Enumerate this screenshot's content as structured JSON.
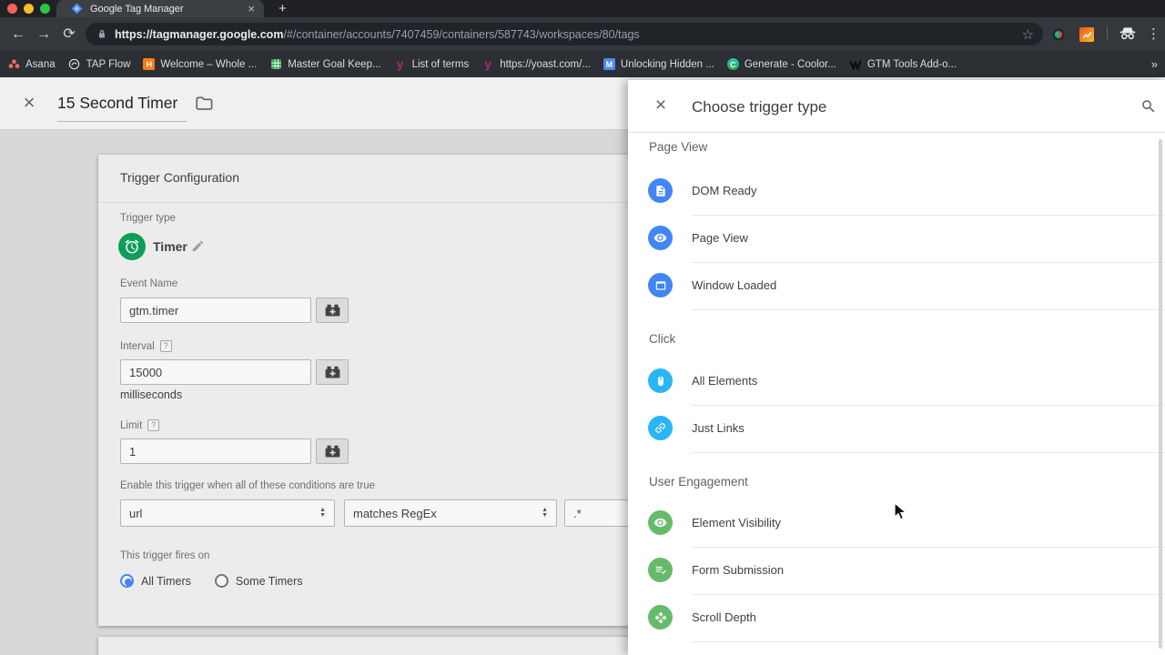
{
  "browser": {
    "tab_title": "Google Tag Manager",
    "tab_close": "×",
    "new_tab": "+",
    "back": "←",
    "forward": "→",
    "reload": "⟳",
    "star": "☆",
    "menu": "⋮",
    "url_domain": "https://tagmanager.google.com",
    "url_path": "/#/container/accounts/7407459/containers/587743/workspaces/80/tags",
    "bookmarks": [
      {
        "label": "Asana"
      },
      {
        "label": "TAP Flow"
      },
      {
        "label": "Welcome – Whole ..."
      },
      {
        "label": "Master Goal Keep..."
      },
      {
        "label": "List of terms"
      },
      {
        "label": "https://yoast.com/..."
      },
      {
        "label": "Unlocking Hidden ..."
      },
      {
        "label": "Generate - Coolor..."
      },
      {
        "label": "GTM Tools Add-o..."
      }
    ],
    "bookmarks_overflow": "»"
  },
  "editor": {
    "close": "×",
    "title": "15 Second Timer",
    "card_title": "Trigger Configuration",
    "trigger_type_label": "Trigger type",
    "trigger_type_value": "Timer",
    "event_name_label": "Event Name",
    "event_name_value": "gtm.timer",
    "interval_label": "Interval",
    "interval_value": "15000",
    "interval_unit": "milliseconds",
    "limit_label": "Limit",
    "limit_value": "1",
    "help_badge": "?",
    "conditions_label": "Enable this trigger when all of these conditions are true",
    "condition_variable": "url",
    "condition_operator": "matches RegEx",
    "condition_value": ".*",
    "fires_on_label": "This trigger fires on",
    "fires_options": [
      {
        "label": "All Timers",
        "selected": true
      },
      {
        "label": "Some Timers",
        "selected": false
      }
    ]
  },
  "panel": {
    "close": "×",
    "title": "Choose trigger type",
    "sections": [
      {
        "name": "Page View",
        "items": [
          {
            "label": "DOM Ready",
            "icon": "dom-ready-document-icon",
            "color": "#4285f4"
          },
          {
            "label": "Page View",
            "icon": "page-view-eye-icon",
            "color": "#4285f4"
          },
          {
            "label": "Window Loaded",
            "icon": "window-loaded-icon",
            "color": "#4285f4"
          }
        ]
      },
      {
        "name": "Click",
        "items": [
          {
            "label": "All Elements",
            "icon": "mouse-icon",
            "color": "#29b6f6"
          },
          {
            "label": "Just Links",
            "icon": "link-icon",
            "color": "#29b6f6"
          }
        ]
      },
      {
        "name": "User Engagement",
        "items": [
          {
            "label": "Element Visibility",
            "icon": "visibility-eye-icon",
            "color": "#66bb6a"
          },
          {
            "label": "Form Submission",
            "icon": "form-check-icon",
            "color": "#66bb6a"
          },
          {
            "label": "Scroll Depth",
            "icon": "scroll-arrows-icon",
            "color": "#66bb6a"
          }
        ]
      }
    ]
  },
  "colors": {
    "timer_green": "#0f9d58",
    "page_view_blue": "#4285f4",
    "click_cyan": "#29b6f6",
    "engagement_green": "#66bb6a",
    "radio_blue": "#4285f4"
  }
}
